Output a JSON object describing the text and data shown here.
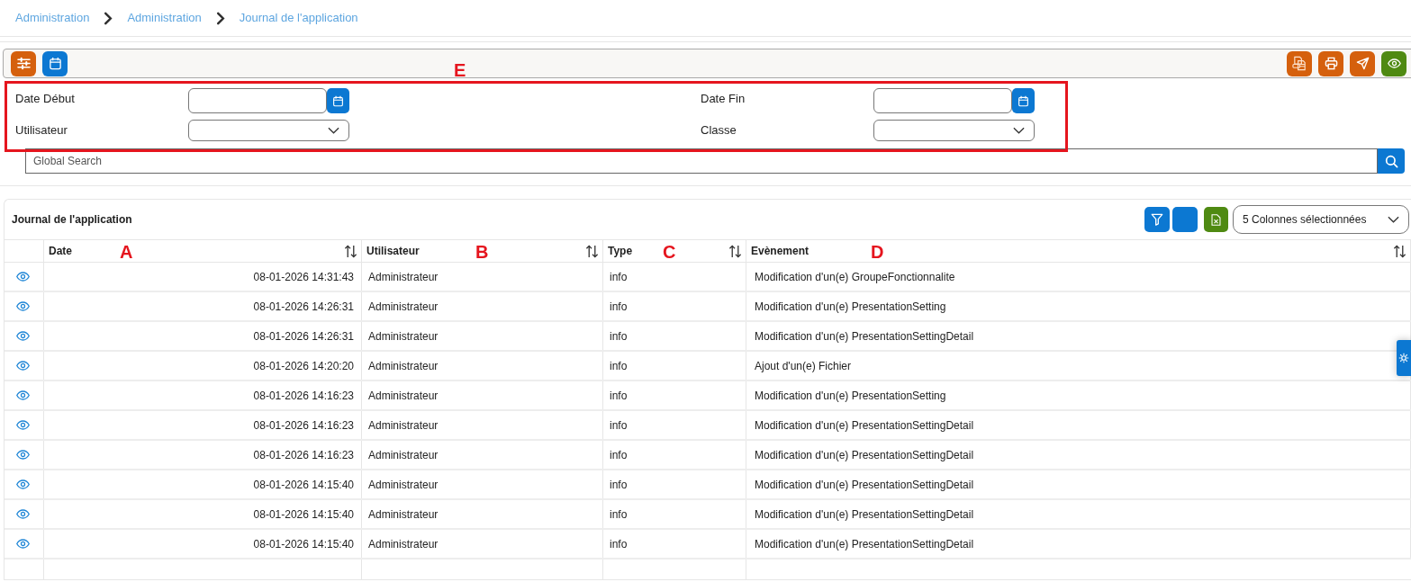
{
  "breadcrumb": [
    {
      "label": "Administration"
    },
    {
      "label": "Administration"
    },
    {
      "label": "Journal de l'application"
    }
  ],
  "filters": {
    "annotation": "E",
    "fields": [
      {
        "label": "Date Début",
        "kind": "date"
      },
      {
        "label": "Date Fin",
        "kind": "date"
      },
      {
        "label": "Utilisateur",
        "kind": "select"
      },
      {
        "label": "Classe",
        "kind": "select"
      }
    ]
  },
  "global_search": {
    "placeholder": "Global Search"
  },
  "table": {
    "title": "Journal de l'application",
    "column_selector": "5 Colonnes sélectionnées",
    "columns": [
      {
        "label": "Date",
        "annotation": "A"
      },
      {
        "label": "Utilisateur",
        "annotation": "B"
      },
      {
        "label": "Type",
        "annotation": "C"
      },
      {
        "label": "Evènement",
        "annotation": "D"
      }
    ],
    "rows": [
      [
        "08-01-2026 14:31:43",
        "Administrateur",
        "info",
        "Modification d'un(e) GroupeFonctionnalite"
      ],
      [
        "08-01-2026 14:26:31",
        "Administrateur",
        "info",
        "Modification d'un(e) PresentationSetting"
      ],
      [
        "08-01-2026 14:26:31",
        "Administrateur",
        "info",
        "Modification d'un(e) PresentationSettingDetail"
      ],
      [
        "08-01-2026 14:20:20",
        "Administrateur",
        "info",
        "Ajout d'un(e) Fichier"
      ],
      [
        "08-01-2026 14:16:23",
        "Administrateur",
        "info",
        "Modification d'un(e) PresentationSetting"
      ],
      [
        "08-01-2026 14:16:23",
        "Administrateur",
        "info",
        "Modification d'un(e) PresentationSettingDetail"
      ],
      [
        "08-01-2026 14:16:23",
        "Administrateur",
        "info",
        "Modification d'un(e) PresentationSettingDetail"
      ],
      [
        "08-01-2026 14:15:40",
        "Administrateur",
        "info",
        "Modification d'un(e) PresentationSettingDetail"
      ],
      [
        "08-01-2026 14:15:40",
        "Administrateur",
        "info",
        "Modification d'un(e) PresentationSettingDetail"
      ],
      [
        "08-01-2026 14:15:40",
        "Administrateur",
        "info",
        "Modification d'un(e) PresentationSettingDetail"
      ]
    ]
  }
}
